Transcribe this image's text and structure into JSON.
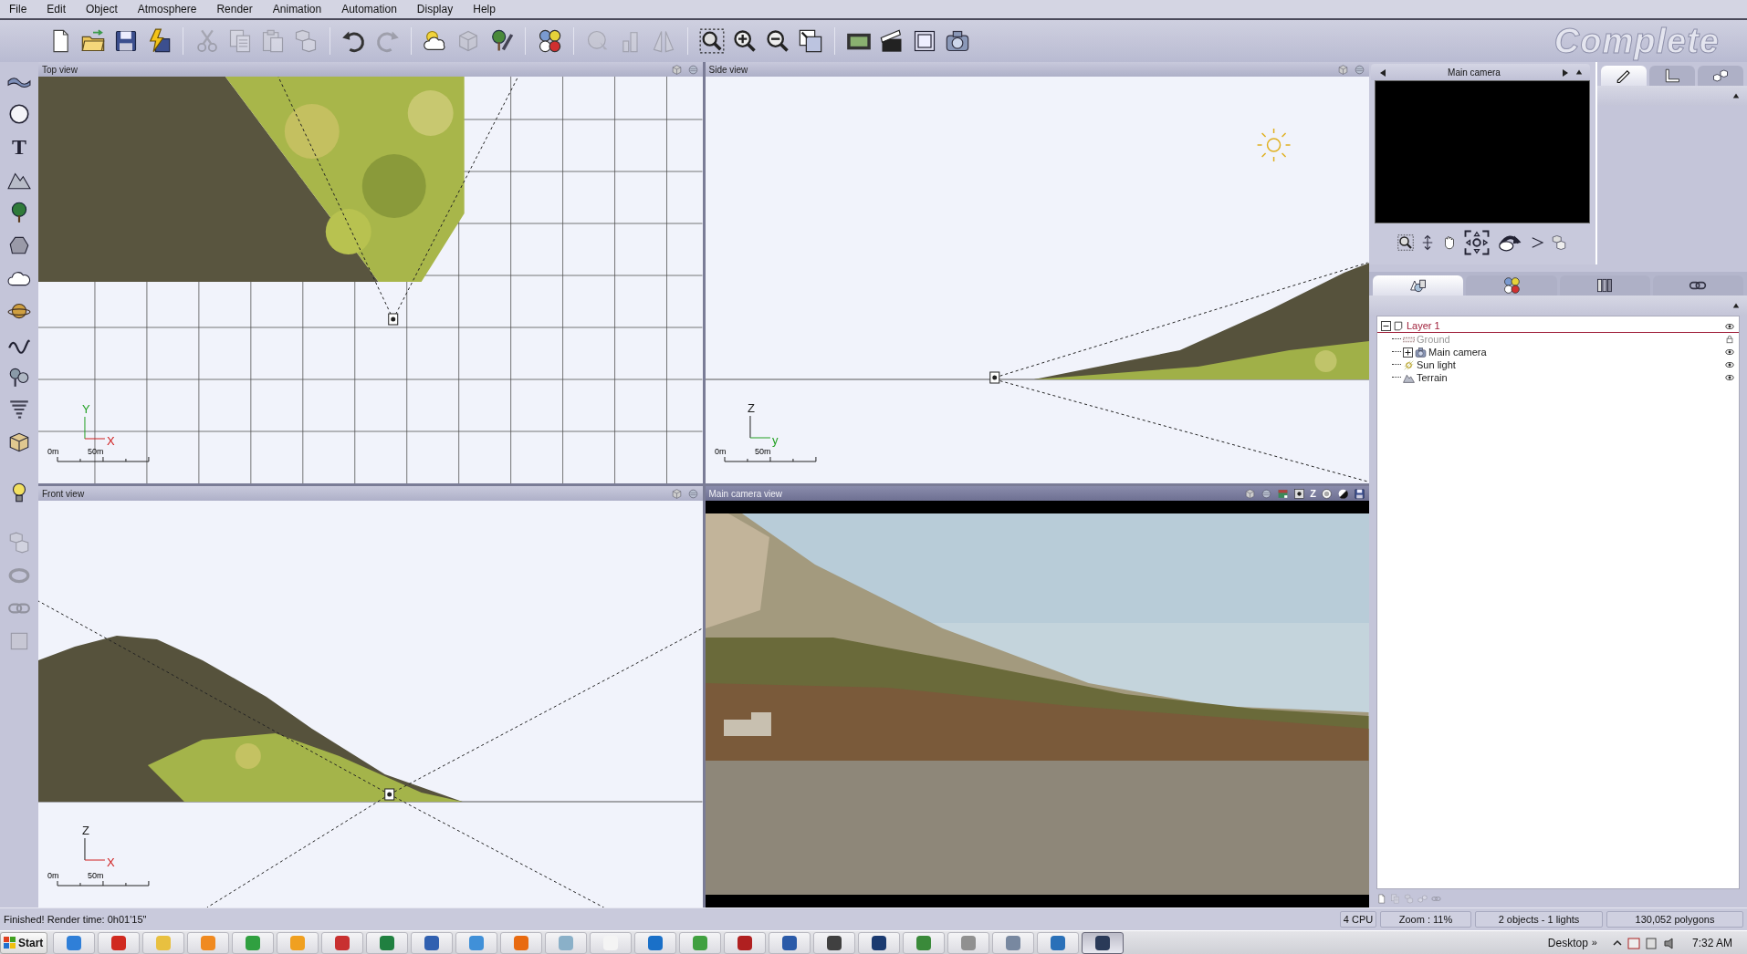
{
  "menu": [
    "File",
    "Edit",
    "Object",
    "Atmosphere",
    "Render",
    "Animation",
    "Automation",
    "Display",
    "Help"
  ],
  "toolbar": [
    [
      {
        "kind": "new",
        "disabled": false
      },
      {
        "kind": "open",
        "disabled": false
      },
      {
        "kind": "save",
        "disabled": false
      },
      {
        "kind": "saveas",
        "disabled": false
      }
    ],
    [
      {
        "kind": "cut",
        "disabled": true
      },
      {
        "kind": "copy",
        "disabled": true
      },
      {
        "kind": "paste",
        "disabled": true
      },
      {
        "kind": "duplicate",
        "disabled": true
      }
    ],
    [
      {
        "kind": "undo",
        "disabled": false
      },
      {
        "kind": "redo",
        "disabled": true
      }
    ],
    [
      {
        "kind": "atmosphere",
        "disabled": false
      },
      {
        "kind": "render",
        "disabled": true
      },
      {
        "kind": "edit",
        "disabled": false
      }
    ],
    [
      {
        "kind": "material",
        "disabled": false
      }
    ],
    [
      {
        "kind": "globe",
        "disabled": true
      },
      {
        "kind": "bars",
        "disabled": true
      },
      {
        "kind": "mirror",
        "disabled": true
      }
    ],
    [
      {
        "kind": "zoomregion",
        "disabled": false
      },
      {
        "kind": "zoomin",
        "disabled": false
      },
      {
        "kind": "zoomout",
        "disabled": false
      },
      {
        "kind": "fit",
        "disabled": false
      }
    ],
    [
      {
        "kind": "film",
        "disabled": false
      },
      {
        "kind": "clapper",
        "disabled": false
      },
      {
        "kind": "frame",
        "disabled": false
      },
      {
        "kind": "camera",
        "disabled": false
      }
    ]
  ],
  "edition": "Complete",
  "tools": [
    {
      "kind": "plane",
      "disabled": false
    },
    {
      "kind": "sphere",
      "disabled": false
    },
    {
      "kind": "text",
      "label": "T",
      "disabled": false
    },
    {
      "kind": "terrain",
      "disabled": false
    },
    {
      "kind": "plant",
      "disabled": false
    },
    {
      "kind": "rock",
      "disabled": false
    },
    {
      "kind": "cloud",
      "disabled": false
    },
    {
      "kind": "planet",
      "disabled": false
    },
    {
      "kind": "path",
      "disabled": false
    },
    {
      "kind": "ecosystem",
      "disabled": false
    },
    {
      "kind": "tornado",
      "disabled": false
    },
    {
      "kind": "object",
      "disabled": false
    },
    {
      "kind": "light",
      "disabled": false
    },
    {
      "kind": "duplicate",
      "disabled": true
    },
    {
      "kind": "torus",
      "disabled": true
    },
    {
      "kind": "link",
      "disabled": true
    },
    {
      "kind": "square",
      "disabled": true
    }
  ],
  "viewports": [
    {
      "title": "Top view",
      "kind": "top",
      "header_tools": [
        {
          "kind": "render"
        },
        {
          "kind": "renderball"
        }
      ],
      "axes": [
        {
          "label": "Y",
          "kind": "vertical",
          "color": "#22a022"
        },
        {
          "label": "X",
          "kind": "horizontal",
          "color": "#d02020"
        }
      ],
      "scale_start": "0m",
      "scale_end": "50m"
    },
    {
      "title": "Side view",
      "kind": "side",
      "header_tools": [
        {
          "kind": "render"
        },
        {
          "kind": "renderball"
        }
      ],
      "axes": [
        {
          "label": "Z",
          "kind": "vertical",
          "color": "#202020"
        },
        {
          "label": "y",
          "kind": "horizontal",
          "color": "#22a022"
        }
      ],
      "scale_start": "0m",
      "scale_end": "50m"
    },
    {
      "title": "Front view",
      "kind": "front",
      "header_tools": [
        {
          "kind": "render"
        },
        {
          "kind": "renderball"
        }
      ],
      "axes": [
        {
          "label": "Z",
          "kind": "vertical",
          "color": "#202020"
        },
        {
          "label": "X",
          "kind": "horizontal",
          "color": "#d02020"
        }
      ],
      "scale_start": "0m",
      "scale_end": "50m"
    },
    {
      "title": "Main camera view",
      "kind": "camera",
      "header_tools": [
        {
          "kind": "render"
        },
        {
          "kind": "renderball"
        },
        {
          "kind": "gradient"
        },
        {
          "kind": "dot"
        },
        {
          "kind": "letter",
          "label": "Z"
        },
        {
          "kind": "contrast"
        },
        {
          "kind": "half"
        },
        {
          "kind": "save"
        }
      ]
    }
  ],
  "camera_preview": {
    "title": "Main camera",
    "controls": [
      {
        "kind": "zoomregion"
      },
      {
        "kind": "vmove"
      },
      {
        "kind": "hand"
      },
      {
        "kind": "pad"
      },
      {
        "kind": "rotate"
      },
      {
        "kind": "play"
      },
      {
        "kind": "duplicate"
      }
    ]
  },
  "editor_tabs": [
    {
      "kind": "pen",
      "selected": true
    },
    {
      "kind": "ruler",
      "selected": false
    },
    {
      "kind": "cubes",
      "selected": false
    }
  ],
  "browser_tabs": [
    {
      "kind": "shapes",
      "selected": true
    },
    {
      "kind": "material",
      "selected": false
    },
    {
      "kind": "library",
      "selected": false
    },
    {
      "kind": "link",
      "selected": false
    }
  ],
  "tree": [
    {
      "label": "Layer 1",
      "kind": "layer",
      "selected": true,
      "expanded": true,
      "children": [
        {
          "label": "Ground",
          "kind": "ground",
          "disabled": true,
          "locked": true
        },
        {
          "label": "Main camera",
          "kind": "camera",
          "disabled": false,
          "locked": false,
          "expanded": false
        },
        {
          "label": "Sun light",
          "kind": "sun",
          "disabled": false,
          "locked": false
        },
        {
          "label": "Terrain",
          "kind": "terrain",
          "disabled": false,
          "locked": false
        }
      ]
    }
  ],
  "browser_footer": [
    {
      "kind": "new",
      "disabled": false
    },
    {
      "kind": "copy",
      "disabled": true
    },
    {
      "kind": "duplicate",
      "disabled": true
    },
    {
      "kind": "cubes",
      "disabled": true
    },
    {
      "kind": "link",
      "disabled": true
    }
  ],
  "status_bar": {
    "message": "Finished! Render time: 0h01'15\"",
    "cpu": "4 CPU",
    "zoom": "Zoom : 11%",
    "objects": "2 objects - 1 lights",
    "polygons": "130,052 polygons"
  },
  "taskbar": {
    "start": "Start",
    "apps": [
      {
        "color": "#2f7fd8",
        "selected": false
      },
      {
        "color": "#d02a20",
        "selected": false
      },
      {
        "color": "#e8c040",
        "selected": false
      },
      {
        "color": "#f08a20",
        "selected": false
      },
      {
        "color": "#30a040",
        "selected": false
      },
      {
        "color": "#f0a020",
        "selected": false
      },
      {
        "color": "#c83030",
        "selected": false
      },
      {
        "color": "#208040",
        "selected": false
      },
      {
        "color": "#3060b0",
        "selected": false
      },
      {
        "color": "#4090d8",
        "selected": false
      },
      {
        "color": "#e86a10",
        "selected": false
      },
      {
        "color": "#8ab0c8",
        "selected": false
      },
      {
        "color": "#f4f4f4",
        "selected": false
      },
      {
        "color": "#1a70c8",
        "selected": false
      },
      {
        "color": "#40a040",
        "selected": false
      },
      {
        "color": "#b02020",
        "selected": false
      },
      {
        "color": "#2a5aa8",
        "selected": false
      },
      {
        "color": "#404040",
        "selected": false
      },
      {
        "color": "#1a3a70",
        "selected": false
      },
      {
        "color": "#3a8a3a",
        "selected": false
      },
      {
        "color": "#909090",
        "selected": false
      },
      {
        "color": "#7888a0",
        "selected": false
      },
      {
        "color": "#2a70b8",
        "selected": false
      },
      {
        "color": "#2a3a58",
        "selected": true
      }
    ],
    "desktop": "Desktop",
    "overflow": "»",
    "time": "7:32 AM"
  }
}
